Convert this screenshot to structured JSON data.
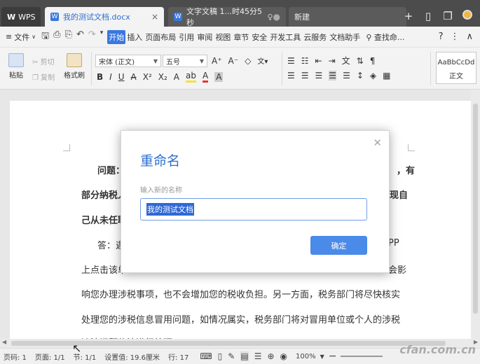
{
  "tabs": {
    "wps": "WPS",
    "doc1": "我的测试文档.docx",
    "doc2": "文字文稿 1...时45分5秒",
    "new_tab": "新建"
  },
  "menubar": {
    "file": "文件",
    "items": [
      "开始",
      "插入",
      "页面布局",
      "引用",
      "审阅",
      "视图",
      "章节",
      "安全",
      "开发工具",
      "云服务",
      "文档助手"
    ],
    "search": "查找命..."
  },
  "ribbon": {
    "paste": "粘贴",
    "cut": "剪切",
    "copy": "复制",
    "format_painter": "格式刷",
    "font_name": "宋体 (正文)",
    "font_size": "五号",
    "style_preview": "AaBbCcDd",
    "style_name": "正文"
  },
  "document": {
    "lines": [
      {
        "text": "问题：",
        "tail": "，有"
      },
      {
        "text": "部分纳税人",
        "tail": "现自"
      },
      {
        "text": "己从未任职",
        "tail": ""
      },
      {
        "text": "答：遇",
        "tail": "PP"
      },
      {
        "text": "上点击该单",
        "tail": "会影"
      },
      {
        "text": "响您办理涉税事项，也不会增加您的税收负担。另一方面，税务部门将尽快核实",
        "tail": ""
      },
      {
        "text": "处理您的涉税信息冒用问题，如情况属实，税务部门将对冒用单位或个人的涉税",
        "tail": ""
      },
      {
        "text": "违法问题依法进行处理。",
        "tail": ""
      }
    ]
  },
  "dialog": {
    "title": "重命名",
    "label": "输入新的名称",
    "value": "我的测试文档",
    "ok": "确定"
  },
  "status": {
    "page_code": "页码: 1",
    "pages": "页面: 1/1",
    "section": "节: 1/1",
    "position": "设置值: 19.6厘米",
    "row": "行: 17",
    "zoom": "100%"
  },
  "watermark": "cfan.com.cn"
}
